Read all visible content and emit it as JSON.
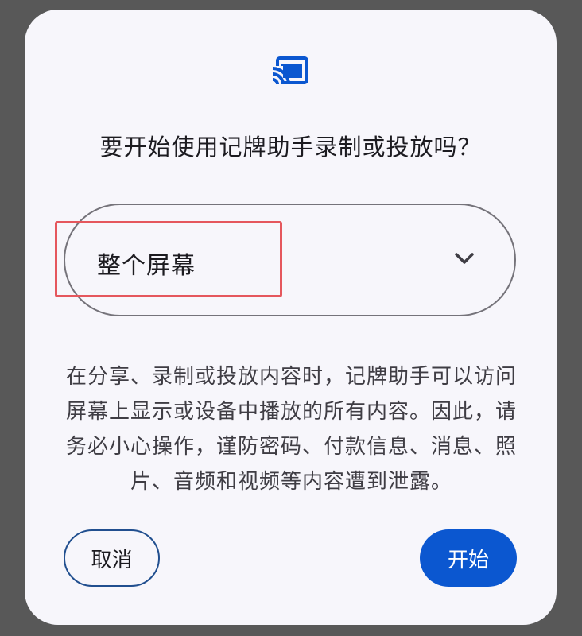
{
  "dialog": {
    "icon": "screen-cast-icon",
    "title": "要开始使用记牌助手录制或投放吗？",
    "select": {
      "value": "整个屏幕",
      "icon": "chevron-down-icon"
    },
    "description": "在分享、录制或投放内容时，记牌助手可以访问屏幕上显示或设备中播放的所有内容。因此，请务必小心操作，谨防密码、付款信息、消息、照片、音频和视频等内容遭到泄露。",
    "buttons": {
      "cancel": "取消",
      "start": "开始"
    }
  },
  "colors": {
    "accent": "#0b57d0",
    "highlight": "#e5575d",
    "dialog_bg": "#f7f6fb",
    "backdrop": "#585858"
  }
}
